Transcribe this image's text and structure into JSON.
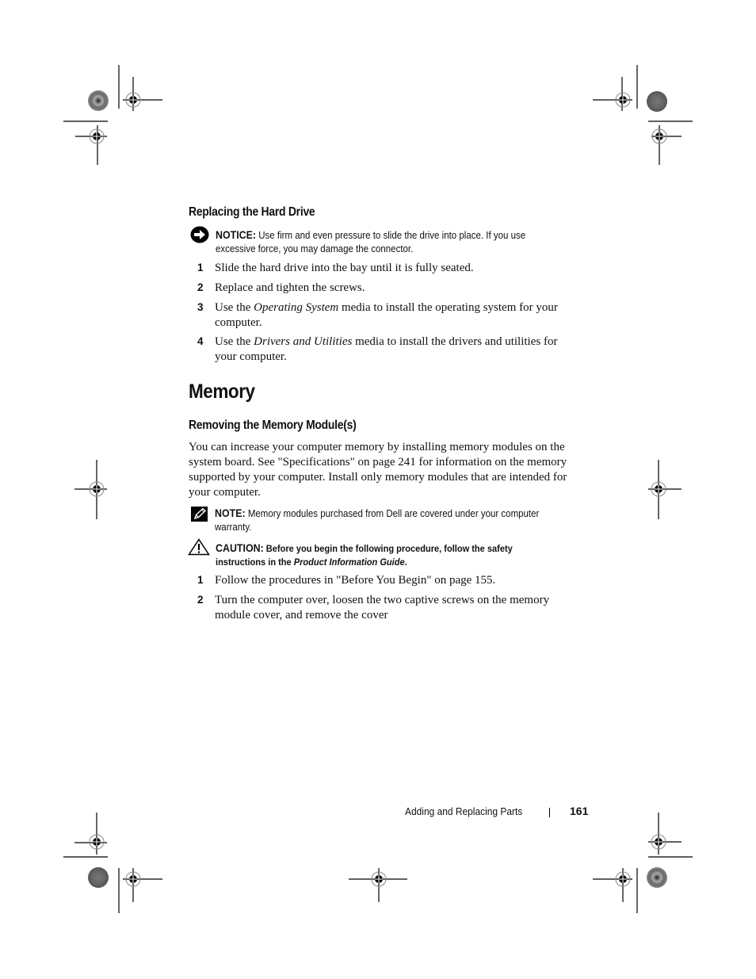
{
  "section_replace_hd": {
    "heading": "Replacing the Hard Drive",
    "notice": {
      "icon": "notice-arrow-icon",
      "label": "NOTICE:",
      "text": " Use firm and even pressure to slide the drive into place. If you use excessive force, you may damage the connector."
    },
    "steps": [
      {
        "num": "1",
        "parts": [
          {
            "t": "Slide the hard drive into the bay until it is fully seated.",
            "i": false
          }
        ]
      },
      {
        "num": "2",
        "parts": [
          {
            "t": "Replace and tighten the screws.",
            "i": false
          }
        ]
      },
      {
        "num": "3",
        "parts": [
          {
            "t": "Use the ",
            "i": false
          },
          {
            "t": "Operating System",
            "i": true
          },
          {
            "t": " media to install the operating system for your computer.",
            "i": false
          }
        ]
      },
      {
        "num": "4",
        "parts": [
          {
            "t": "Use the ",
            "i": false
          },
          {
            "t": "Drivers and Utilities",
            "i": true
          },
          {
            "t": " media to install the drivers and utilities for your computer.",
            "i": false
          }
        ]
      }
    ]
  },
  "section_memory": {
    "title": "Memory",
    "subheading": "Removing the Memory Module(s)",
    "paragraph": "You can increase your computer memory by installing memory modules on the system board. See \"Specifications\" on page 241 for information on the memory supported by your computer. Install only memory modules that are intended for your computer.",
    "note": {
      "icon": "pencil-note-icon",
      "label": "NOTE:",
      "text": " Memory modules purchased from Dell are covered under your computer warranty."
    },
    "caution": {
      "icon": "warning-triangle-icon",
      "label": "CAUTION:",
      "text_before": " Before you begin the following procedure, follow the safety instructions in the ",
      "text_italic": "Product Information Guide",
      "text_after": "."
    },
    "steps": [
      {
        "num": "1",
        "parts": [
          {
            "t": "Follow the procedures in \"Before You Begin\" on page 155.",
            "i": false
          }
        ]
      },
      {
        "num": "2",
        "parts": [
          {
            "t": "Turn the computer over, loosen the two captive screws on the memory module cover, and remove the cover",
            "i": false
          }
        ]
      }
    ]
  },
  "footer": {
    "chapter": "Adding and Replacing Parts",
    "separator": "|",
    "page_number": "161"
  }
}
